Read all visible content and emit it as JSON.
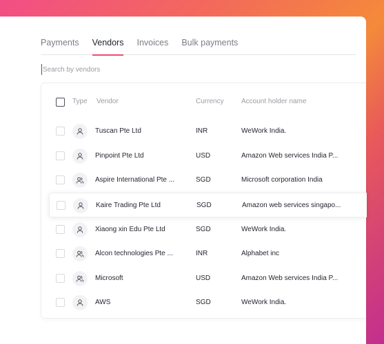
{
  "tabs": [
    {
      "label": "Payments",
      "active": false
    },
    {
      "label": "Vendors",
      "active": true
    },
    {
      "label": "Invoices",
      "active": false
    },
    {
      "label": "Bulk payments",
      "active": false
    }
  ],
  "search": {
    "placeholder": "Search by vendors",
    "value": ""
  },
  "table": {
    "headers": {
      "type": "Type",
      "vendor": "Vendor",
      "currency": "Currency",
      "account": "Account holder name"
    },
    "rows": [
      {
        "type_icon": "person-icon",
        "vendor": "Tuscan Pte Ltd",
        "currency": "INR",
        "account": "WeWork India."
      },
      {
        "type_icon": "person-icon",
        "vendor": "Pinpoint Pte Ltd",
        "currency": "USD",
        "account": "Amazon Web services India P..."
      },
      {
        "type_icon": "group-icon",
        "vendor": "Aspire International Pte ...",
        "currency": "SGD",
        "account": "Microsoft corporation India"
      },
      {
        "type_icon": "person-icon",
        "vendor": "Kaire Trading Pte Ltd",
        "currency": "SGD",
        "account": "Amazon web services singapo..."
      },
      {
        "type_icon": "person-icon",
        "vendor": "Xiaong xin Edu Pte Ltd",
        "currency": "SGD",
        "account": "WeWork India."
      },
      {
        "type_icon": "group-icon",
        "vendor": "Alcon technologies Pte ...",
        "currency": "INR",
        "account": "Alphabet inc"
      },
      {
        "type_icon": "group-icon",
        "vendor": "Microsoft",
        "currency": "USD",
        "account": "Amazon Web services India P..."
      },
      {
        "type_icon": "person-icon",
        "vendor": "AWS",
        "currency": "SGD",
        "account": "WeWork India."
      }
    ]
  },
  "colors": {
    "accent": "#ef4b6c",
    "text": "#24262f",
    "muted": "#9a9ca4"
  }
}
